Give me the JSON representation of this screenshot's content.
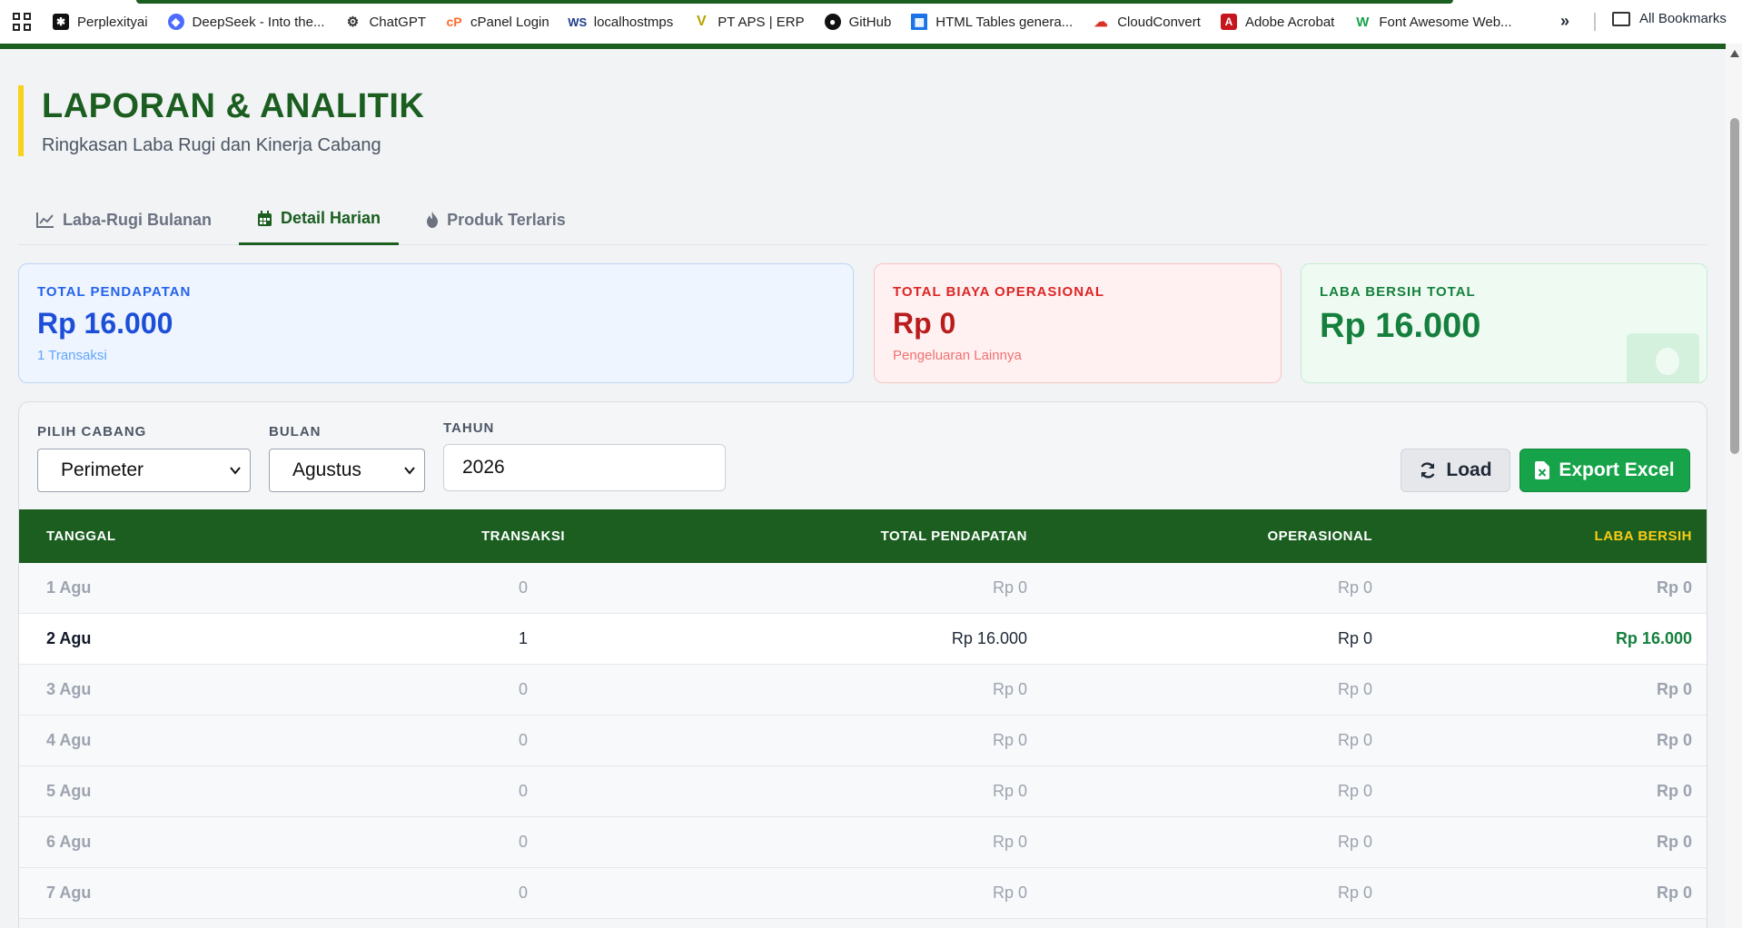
{
  "bookmarks": {
    "items": [
      {
        "label": "Perplexityai",
        "icon": "perplexity-icon"
      },
      {
        "label": "DeepSeek - Into the...",
        "icon": "deepseek-icon"
      },
      {
        "label": "ChatGPT",
        "icon": "chatgpt-icon"
      },
      {
        "label": "cPanel Login",
        "icon": "cpanel-icon"
      },
      {
        "label": "localhostmps",
        "icon": "ws-icon"
      },
      {
        "label": "PT APS | ERP",
        "icon": "v-logo-icon"
      },
      {
        "label": "GitHub",
        "icon": "github-icon"
      },
      {
        "label": "HTML Tables genera...",
        "icon": "table-icon"
      },
      {
        "label": "CloudConvert",
        "icon": "cloud-icon"
      },
      {
        "label": "Adobe Acrobat",
        "icon": "acrobat-icon"
      },
      {
        "label": "Font Awesome Web...",
        "icon": "fontawesome-icon"
      }
    ],
    "more": "»",
    "all_bookmarks": "All Bookmarks"
  },
  "header": {
    "title": "LAPORAN & ANALITIK",
    "subtitle": "Ringkasan Laba Rugi dan Kinerja Cabang"
  },
  "tabs": [
    {
      "label": "Laba-Rugi Bulanan",
      "icon": "chart-line-icon"
    },
    {
      "label": "Detail Harian",
      "icon": "calendar-icon"
    },
    {
      "label": "Produk Terlaris",
      "icon": "fire-icon"
    }
  ],
  "cards": {
    "revenue": {
      "label": "TOTAL PENDAPATAN",
      "value": "Rp 16.000",
      "note": "1 Transaksi"
    },
    "opex": {
      "label": "TOTAL BIAYA OPERASIONAL",
      "value": "Rp 0",
      "note": "Pengeluaran Lainnya"
    },
    "net": {
      "label": "LABA BERSIH TOTAL",
      "value": "Rp 16.000"
    }
  },
  "filters": {
    "branch": {
      "label": "PILIH CABANG",
      "value": "Perimeter"
    },
    "month": {
      "label": "BULAN",
      "value": "Agustus"
    },
    "year": {
      "label": "TAHUN",
      "value": "2026"
    },
    "load_label": "Load",
    "export_label": "Export Excel"
  },
  "table": {
    "headers": [
      "TANGGAL",
      "TRANSAKSI",
      "TOTAL PENDAPATAN",
      "OPERASIONAL",
      "LABA BERSIH"
    ],
    "rows": [
      [
        "1 Agu",
        "0",
        "Rp 0",
        "Rp 0",
        "Rp 0"
      ],
      [
        "2 Agu",
        "1",
        "Rp 16.000",
        "Rp 0",
        "Rp 16.000"
      ],
      [
        "3 Agu",
        "0",
        "Rp 0",
        "Rp 0",
        "Rp 0"
      ],
      [
        "4 Agu",
        "0",
        "Rp 0",
        "Rp 0",
        "Rp 0"
      ],
      [
        "5 Agu",
        "0",
        "Rp 0",
        "Rp 0",
        "Rp 0"
      ],
      [
        "6 Agu",
        "0",
        "Rp 0",
        "Rp 0",
        "Rp 0"
      ],
      [
        "7 Agu",
        "0",
        "Rp 0",
        "Rp 0",
        "Rp 0"
      ]
    ]
  },
  "colors": {
    "brand_green": "#1b5e20",
    "accent_yellow": "#f7d21a",
    "export_green": "#16a34a"
  }
}
